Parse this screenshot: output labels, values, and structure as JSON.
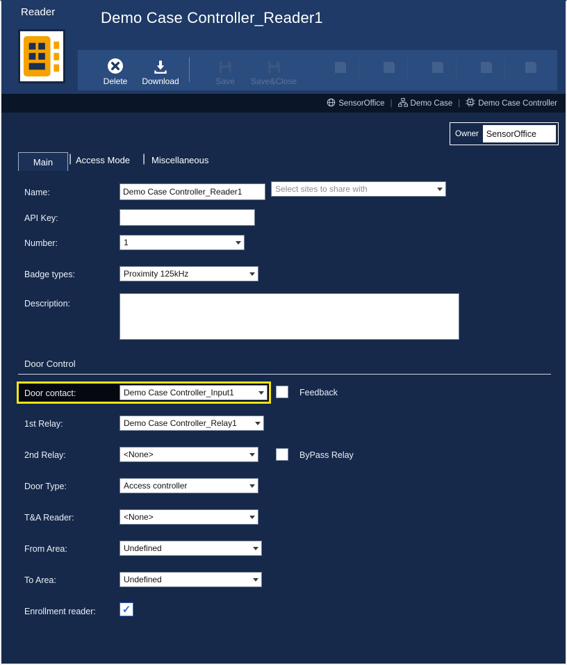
{
  "colors": {
    "header": "#1f3a66",
    "toolbar_band": "#2b4c7e",
    "breadcrumb_bar": "#0a1628",
    "body": "#16294a",
    "highlight_yellow": "#f7e512",
    "icon_orange": "#f5a200",
    "check_blue": "#2f6fd6"
  },
  "window": {
    "app_label": "Reader",
    "title": "Demo Case Controller_Reader1"
  },
  "toolbar": {
    "delete_label": "Delete",
    "download_label": "Download",
    "save_label": "Save",
    "save_close_label": "Save&Close"
  },
  "breadcrumb": {
    "sep": "|",
    "items": [
      {
        "label": "SensorOffice",
        "icon": "globe-icon"
      },
      {
        "label": "Demo Case",
        "icon": "sitemap-icon"
      },
      {
        "label": "Demo Case Controller",
        "icon": "controller-chip-icon"
      }
    ]
  },
  "owner": {
    "label": "Owner",
    "value": "SensorOffice"
  },
  "tabs": {
    "sep": "|",
    "items": [
      {
        "label": "Main",
        "active": true
      },
      {
        "label": "Access Mode",
        "active": false
      },
      {
        "label": "Miscellaneous",
        "active": false
      }
    ]
  },
  "form": {
    "name": {
      "label": "Name:",
      "value": "Demo Case Controller_Reader1"
    },
    "share": {
      "placeholder": "Select sites to share with"
    },
    "api_key": {
      "label": "API Key:",
      "value": ""
    },
    "number": {
      "label": "Number:",
      "value": "1"
    },
    "badge_types": {
      "label": "Badge types:",
      "value": "Proximity 125kHz"
    },
    "description": {
      "label": "Description:",
      "value": ""
    },
    "section": {
      "heading": "Door Control"
    },
    "door_contact": {
      "label": "Door contact:",
      "value": "Demo Case Controller_Input1",
      "highlighted": true
    },
    "feedback": {
      "label": "Feedback",
      "checked": false
    },
    "first_relay": {
      "label": "1st Relay:",
      "value": "Demo Case Controller_Relay1"
    },
    "second_relay": {
      "label": "2nd Relay:",
      "value": "<None>"
    },
    "bypass_relay": {
      "label": "ByPass Relay",
      "checked": false
    },
    "door_type": {
      "label": "Door Type:",
      "value": "Access controller"
    },
    "ta_reader": {
      "label": "T&A Reader:",
      "value": "<None>"
    },
    "from_area": {
      "label": "From Area:",
      "value": "Undefined"
    },
    "to_area": {
      "label": "To Area:",
      "value": "Undefined"
    },
    "enrollment_reader": {
      "label": "Enrollment reader:",
      "checked": true
    }
  }
}
